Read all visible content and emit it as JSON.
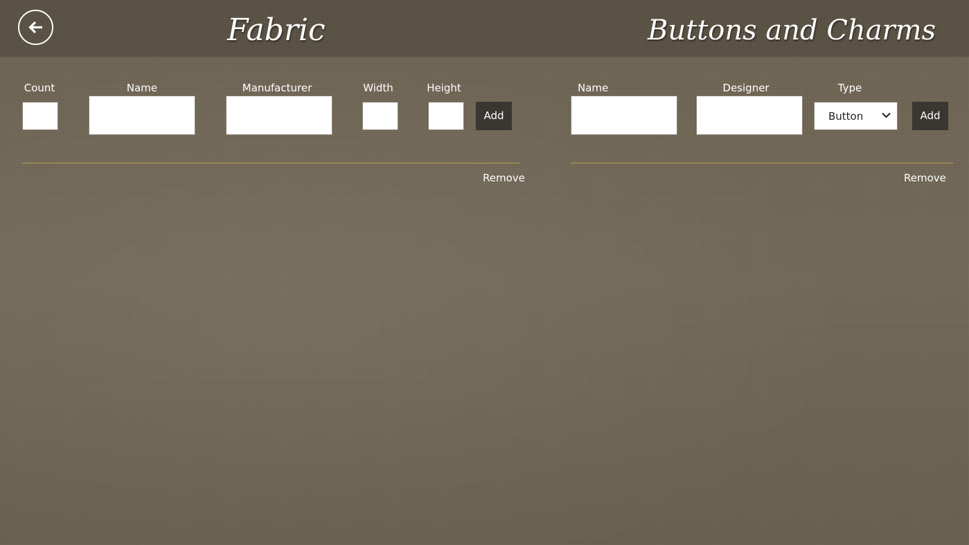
{
  "header": {
    "back_icon": "arrow-left-icon",
    "fabric_title": "Fabric",
    "charms_title": "Buttons and Charms"
  },
  "fabric": {
    "count_label": "Count",
    "name_label": "Name",
    "manufacturer_label": "Manufacturer",
    "width_label": "Width",
    "height_label": "Height",
    "count_value": "",
    "name_value": "",
    "manufacturer_value": "",
    "width_value": "",
    "height_value": "",
    "add_label": "Add",
    "remove_label": "Remove"
  },
  "charms": {
    "name_label": "Name",
    "designer_label": "Designer",
    "type_label": "Type",
    "name_value": "",
    "designer_value": "",
    "type_selected": "Button",
    "add_label": "Add",
    "remove_label": "Remove"
  },
  "colors": {
    "divider": "#b59a45",
    "button_bg": "#3a3631",
    "background": "#706452"
  }
}
